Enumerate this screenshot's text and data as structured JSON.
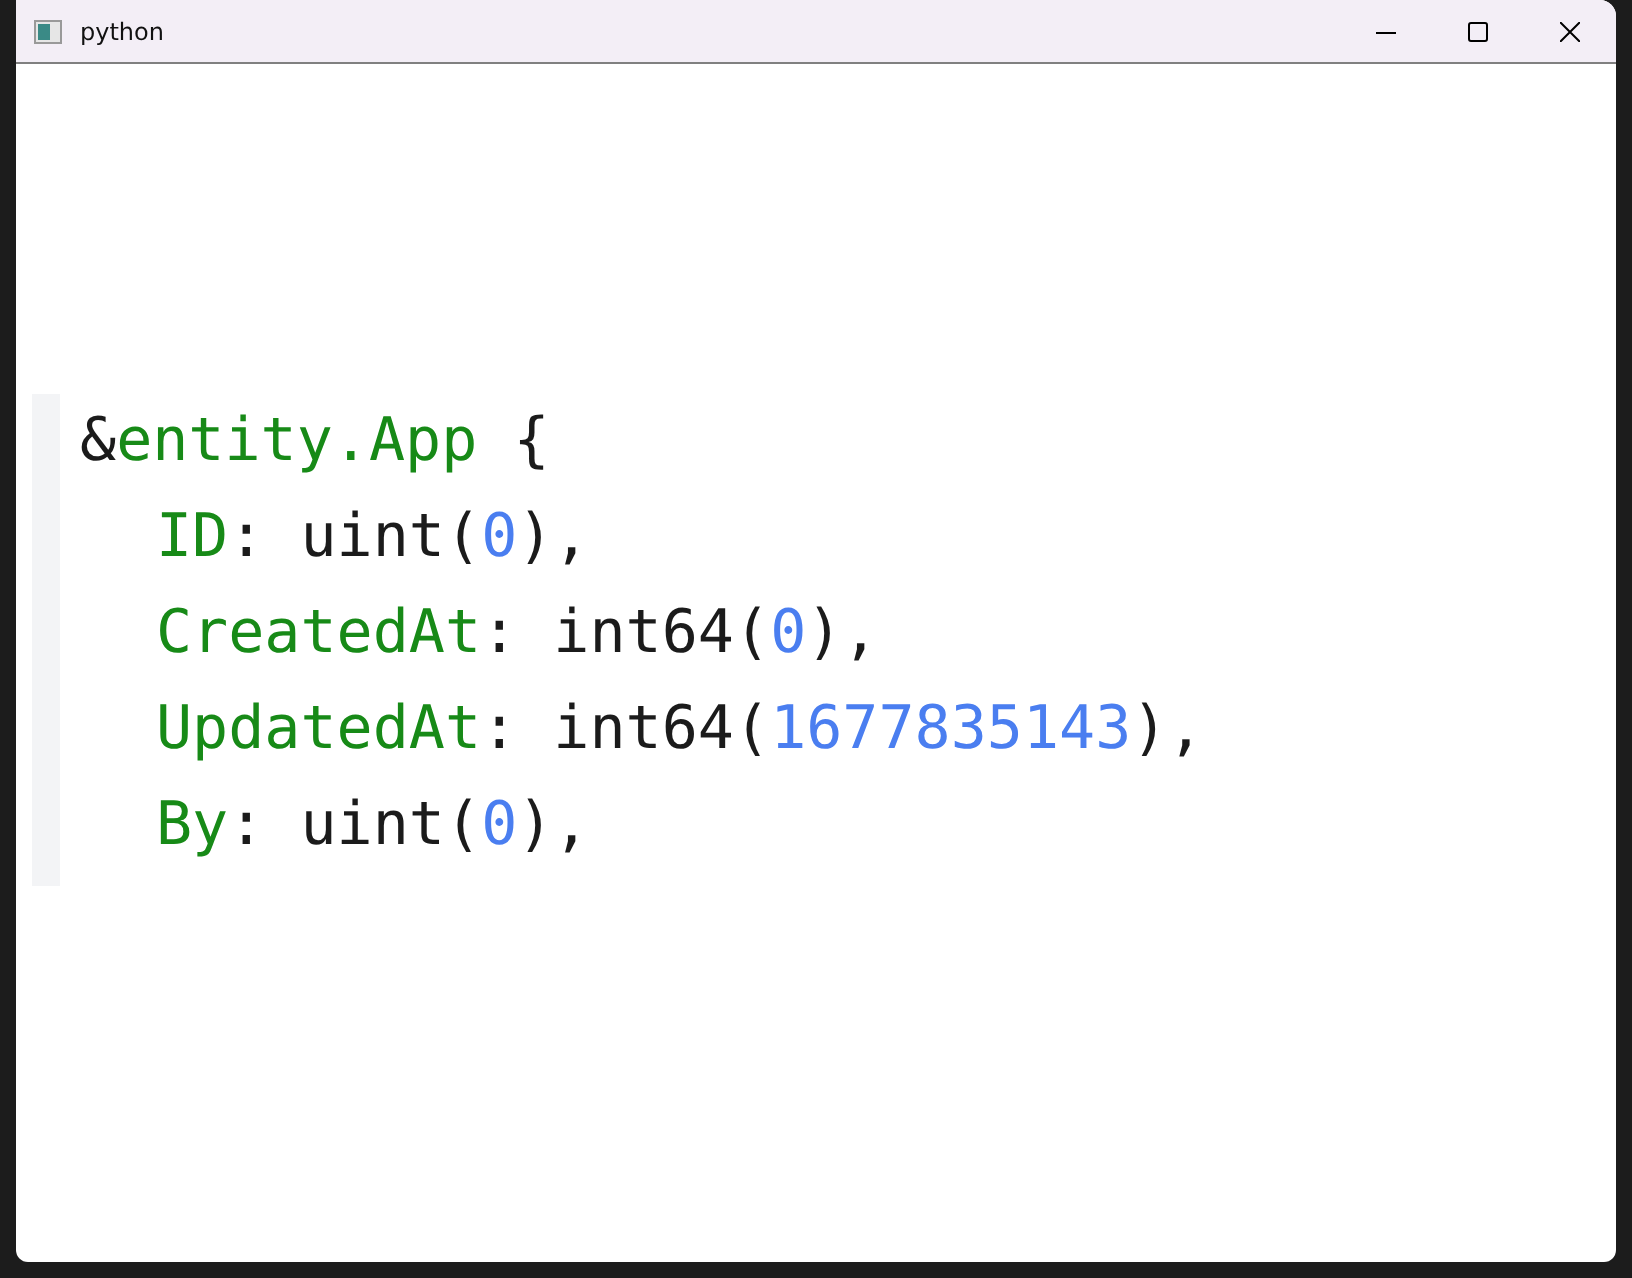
{
  "window": {
    "title": "python"
  },
  "code": {
    "tokens": [
      {
        "text": "&",
        "kind": "punct"
      },
      {
        "text": "entity.App",
        "kind": "ident"
      },
      {
        "text": " {",
        "kind": "punct"
      }
    ],
    "children": [
      {
        "tokens": [
          {
            "text": "ID",
            "kind": "ident"
          },
          {
            "text": ": uint(",
            "kind": "punct"
          },
          {
            "text": "0",
            "kind": "number"
          },
          {
            "text": "),",
            "kind": "punct"
          }
        ]
      },
      {
        "tokens": [
          {
            "text": "CreatedAt",
            "kind": "ident"
          },
          {
            "text": ": int64(",
            "kind": "punct"
          },
          {
            "text": "0",
            "kind": "number"
          },
          {
            "text": "),",
            "kind": "punct"
          }
        ]
      },
      {
        "tokens": [
          {
            "text": "UpdatedAt",
            "kind": "ident"
          },
          {
            "text": ": int64(",
            "kind": "punct"
          },
          {
            "text": "1677835143",
            "kind": "number"
          },
          {
            "text": "),",
            "kind": "punct"
          }
        ]
      },
      {
        "tokens": [
          {
            "text": "By",
            "kind": "ident"
          },
          {
            "text": ": uint(",
            "kind": "punct"
          },
          {
            "text": "0",
            "kind": "number"
          },
          {
            "text": "),",
            "kind": "punct"
          }
        ]
      }
    ]
  }
}
